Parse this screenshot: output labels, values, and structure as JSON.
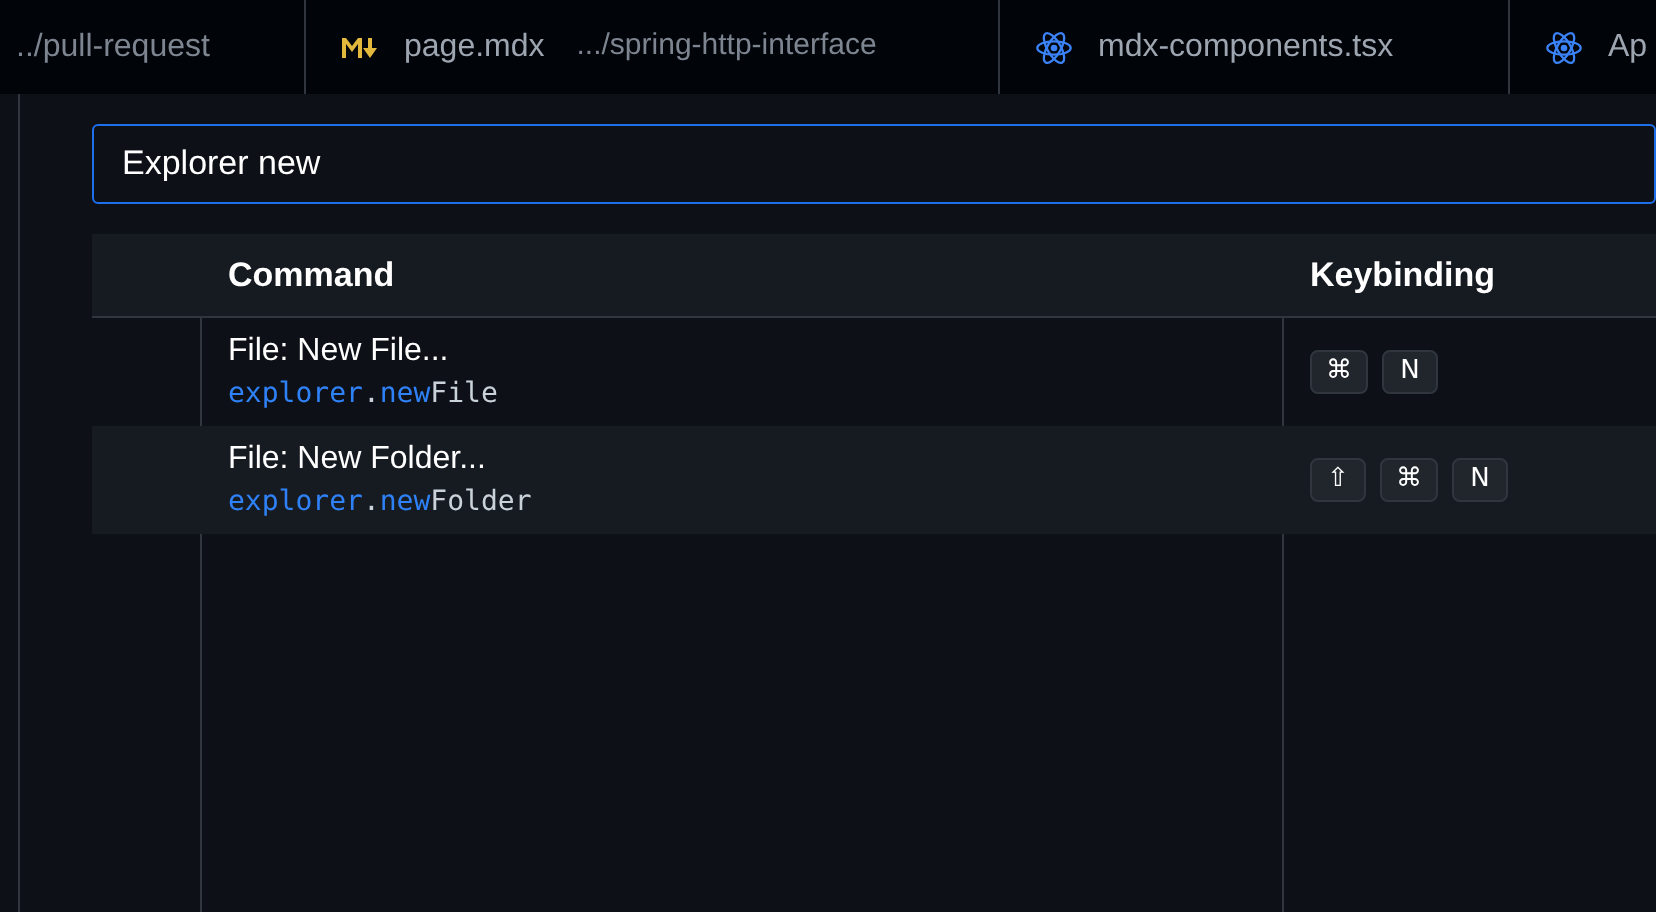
{
  "tabs": [
    {
      "label": "../pull-request",
      "kind": "plain",
      "selected": false
    },
    {
      "label": "page.mdx",
      "description": ".../spring-http-interface",
      "kind": "markdown",
      "selected": false
    },
    {
      "label": "mdx-components.tsx",
      "kind": "react",
      "selected": false
    },
    {
      "label": "Ap",
      "kind": "react",
      "selected": false
    }
  ],
  "search": {
    "value": "Explorer new"
  },
  "table": {
    "columns": [
      "Command",
      "Keybinding"
    ],
    "rows": [
      {
        "title": "File: New File...",
        "command": [
          {
            "text": "explorer",
            "match": true
          },
          {
            "text": ".",
            "match": false
          },
          {
            "text": "new",
            "match": true
          },
          {
            "text": "File",
            "match": false
          }
        ],
        "keys": [
          "⌘",
          "N"
        ],
        "selected": false
      },
      {
        "title": "File: New Folder...",
        "command": [
          {
            "text": "explorer",
            "match": true
          },
          {
            "text": ".",
            "match": false
          },
          {
            "text": "new",
            "match": true
          },
          {
            "text": "Folder",
            "match": false
          }
        ],
        "keys": [
          "⇧",
          "⌘",
          "N"
        ],
        "selected": true
      }
    ]
  }
}
